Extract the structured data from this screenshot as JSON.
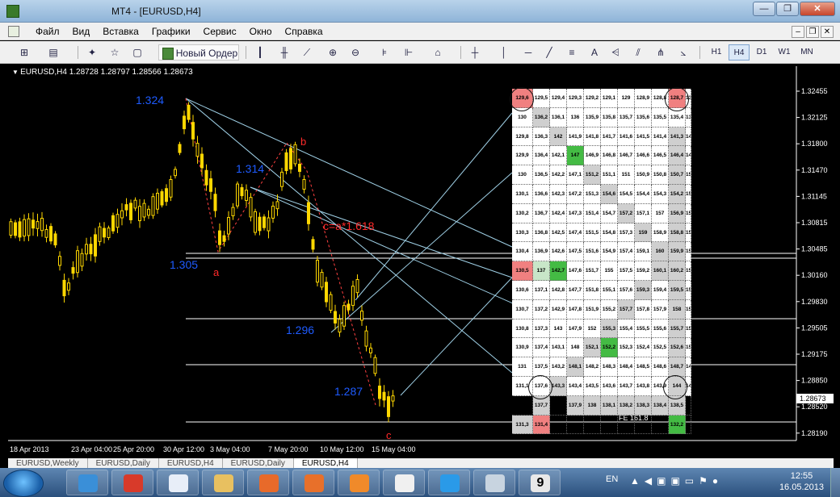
{
  "window": {
    "title": "MT4 - [EURUSD,H4]"
  },
  "menu": [
    "Файл",
    "Вид",
    "Вставка",
    "Графики",
    "Сервис",
    "Окно",
    "Справка"
  ],
  "toolbar": {
    "new_order": "Новый Ордер",
    "text_tool": "A",
    "timeframes": [
      "H1",
      "H4",
      "D1",
      "W1",
      "MN"
    ],
    "active_timeframe": "H4"
  },
  "chart": {
    "header": "EURUSD,H4  1.28728 1.28797 1.28566 1.28673",
    "price_labels": [
      "1.32455",
      "1.32125",
      "1.31800",
      "1.31470",
      "1.31145",
      "1.30815",
      "1.30485",
      "1.30160",
      "1.29830",
      "1.29505",
      "1.29175",
      "1.28850",
      "1.28520",
      "1.28190"
    ],
    "current_price": "1.28673",
    "time_labels": [
      "18 Apr 2013",
      "23 Apr 04:00",
      "25 Apr 20:00",
      "30 Apr 12:00",
      "3 May 04:00",
      "7 May 20:00",
      "10 May 12:00",
      "15 May 04:00"
    ],
    "annotations": {
      "p1324": "1.324",
      "p1314": "1.314",
      "p1305": "1.305",
      "p1296": "1.296",
      "p1287": "1.287",
      "a": "a",
      "b": "b",
      "c": "c",
      "formula": "c=a*1.618",
      "fe": "FE 161.8"
    },
    "colors": {
      "candles": "#ffd700",
      "annotation_blue": "#1e5bff",
      "annotation_red": "#ff2a2a",
      "lines": "#ffffff"
    }
  },
  "grid": {
    "rows": [
      [
        "129,6",
        "129,5",
        "129,4",
        "129,3",
        "129,2",
        "129,1",
        "129",
        "128,9",
        "128,8",
        "128,7",
        "13"
      ],
      [
        "130",
        "136,2",
        "136,1",
        "136",
        "135,9",
        "135,8",
        "135,7",
        "135,6",
        "135,5",
        "135,4",
        "13"
      ],
      [
        "129,8",
        "136,3",
        "142",
        "141,9",
        "141,8",
        "141,7",
        "141,6",
        "141,5",
        "141,4",
        "141,3",
        "14"
      ],
      [
        "129,9",
        "136,4",
        "142,1",
        "147",
        "146,9",
        "146,8",
        "146,7",
        "146,6",
        "146,5",
        "146,4",
        "14"
      ],
      [
        "130",
        "136,5",
        "142,2",
        "147,1",
        "151,2",
        "151,1",
        "151",
        "150,9",
        "150,8",
        "150,7",
        "15"
      ],
      [
        "130,1",
        "136,6",
        "142,3",
        "147,2",
        "151,3",
        "154,6",
        "154,5",
        "154,4",
        "154,3",
        "154,2",
        "15"
      ],
      [
        "130,2",
        "136,7",
        "142,4",
        "147,3",
        "151,4",
        "154,7",
        "157,2",
        "157,1",
        "157",
        "156,9",
        "15"
      ],
      [
        "130,3",
        "136,8",
        "142,5",
        "147,4",
        "151,5",
        "154,8",
        "157,3",
        "159",
        "158,9",
        "158,8",
        "15"
      ],
      [
        "130,4",
        "136,9",
        "142,6",
        "147,5",
        "151,6",
        "154,9",
        "157,4",
        "159,1",
        "160",
        "159,9",
        "15"
      ],
      [
        "130,5",
        "137",
        "142,7",
        "147,6",
        "151,7",
        "155",
        "157,5",
        "159,2",
        "160,1",
        "160,2",
        "15"
      ],
      [
        "130,6",
        "137,1",
        "142,8",
        "147,7",
        "151,8",
        "155,1",
        "157,6",
        "159,3",
        "159,4",
        "159,5",
        "15"
      ],
      [
        "130,7",
        "137,2",
        "142,9",
        "147,8",
        "151,9",
        "155,2",
        "157,7",
        "157,8",
        "157,9",
        "158",
        "15"
      ],
      [
        "130,8",
        "137,3",
        "143",
        "147,9",
        "152",
        "155,3",
        "155,4",
        "155,5",
        "155,6",
        "155,7",
        "15"
      ],
      [
        "130,9",
        "137,4",
        "143,1",
        "148",
        "152,1",
        "152,2",
        "152,3",
        "152,4",
        "152,5",
        "152,6",
        "15"
      ],
      [
        "131",
        "137,5",
        "143,2",
        "148,1",
        "148,2",
        "148,3",
        "148,4",
        "148,5",
        "148,6",
        "148,7",
        "14"
      ],
      [
        "131,1",
        "137,6",
        "143,3",
        "143,4",
        "143,5",
        "143,6",
        "143,7",
        "143,8",
        "143,9",
        "144",
        "14"
      ],
      [
        "131,2",
        "137,7",
        "137,8",
        "137,9",
        "138",
        "138,1",
        "138,2",
        "138,3",
        "138,4",
        "138,5",
        "13"
      ],
      [
        "131,3",
        "131,4",
        "131,5",
        "131,6",
        "131,7",
        "131,8",
        "131,9",
        "132",
        "132,1",
        "132,2",
        "13"
      ]
    ]
  },
  "tabs": [
    "EURUSD,Weekly",
    "EURUSD,Daily",
    "EURUSD,H4",
    "EURUSD,Daily",
    "EURUSD,H4"
  ],
  "active_tab": 4,
  "taskbar": {
    "lang": "EN",
    "time": "12:55",
    "date": "16.05.2013",
    "badge": "9"
  }
}
